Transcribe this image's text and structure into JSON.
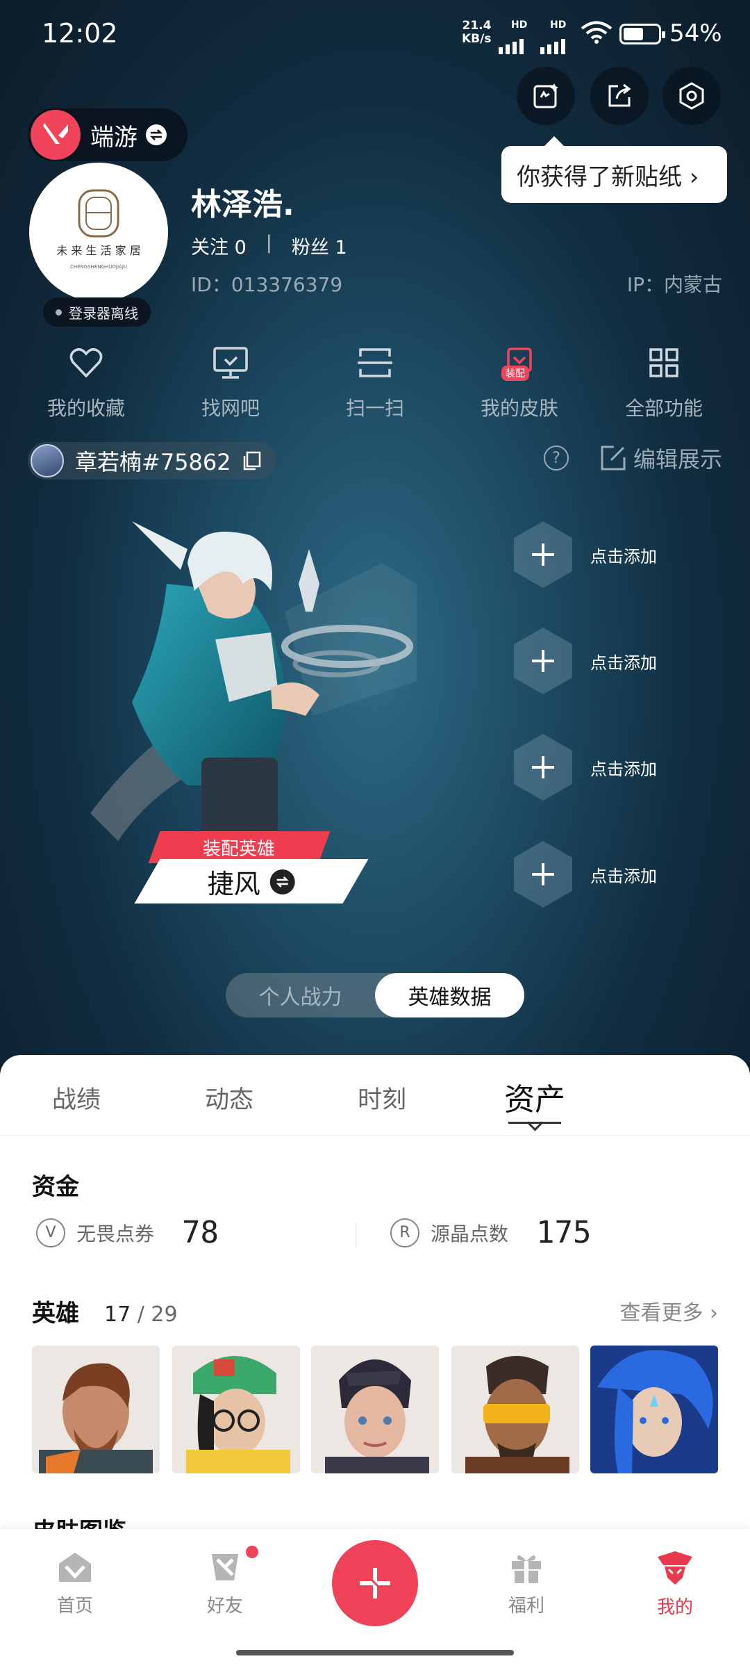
{
  "status_bar": {
    "time": "12:02",
    "net_speed_top": "21.4",
    "net_speed_unit": "KB/s",
    "hd1": "HD",
    "hd2": "HD",
    "battery": "54%"
  },
  "header": {
    "game_name": "端游",
    "sticker_tip": "你获得了新贴纸 ›",
    "nickname": "林泽浩.",
    "follow_label": "关注 0",
    "fans_label": "粉丝 1",
    "separator": "|",
    "id_text": "ID：013376379",
    "ip_text": "IP：内蒙古",
    "login_status": "登录器离线"
  },
  "shortcuts": [
    {
      "label": "我的收藏",
      "icon": "heart-icon"
    },
    {
      "label": "找网吧",
      "icon": "monitor-icon"
    },
    {
      "label": "扫一扫",
      "icon": "scan-icon"
    },
    {
      "label": "我的皮肤",
      "icon": "skin-icon",
      "badge": "装配"
    },
    {
      "label": "全部功能",
      "icon": "grid-icon"
    }
  ],
  "riot_id": "章若楠#75862",
  "edit_label": "编辑展示",
  "help_glyph": "?",
  "hero": {
    "equip_tag": "装配英雄",
    "name": "捷风"
  },
  "add_slots": [
    "点击添加",
    "点击添加",
    "点击添加",
    "点击添加"
  ],
  "mode_toggle": {
    "left": "个人战力",
    "right": "英雄数据"
  },
  "tabs": [
    "战绩",
    "动态",
    "时刻",
    "资产"
  ],
  "assets": {
    "funds_title": "资金",
    "funds": [
      {
        "label": "无畏点券",
        "value": "78",
        "icon": "V"
      },
      {
        "label": "源晶点数",
        "value": "175",
        "icon": "R"
      }
    ],
    "heroes_title": "英雄",
    "heroes_owned": "17",
    "heroes_total": "/ 29",
    "see_more": "查看更多",
    "skins_title": "皮肤图鉴"
  },
  "bottom_nav": [
    {
      "label": "首页",
      "icon": "home-icon"
    },
    {
      "label": "好友",
      "icon": "friends-icon"
    },
    {
      "label": "福利",
      "icon": "gift-icon"
    },
    {
      "label": "我的",
      "icon": "profile-icon"
    }
  ],
  "colors": {
    "accent": "#ef4157",
    "bg_dark": "#0e1d29",
    "teal": "#2e6a84"
  }
}
